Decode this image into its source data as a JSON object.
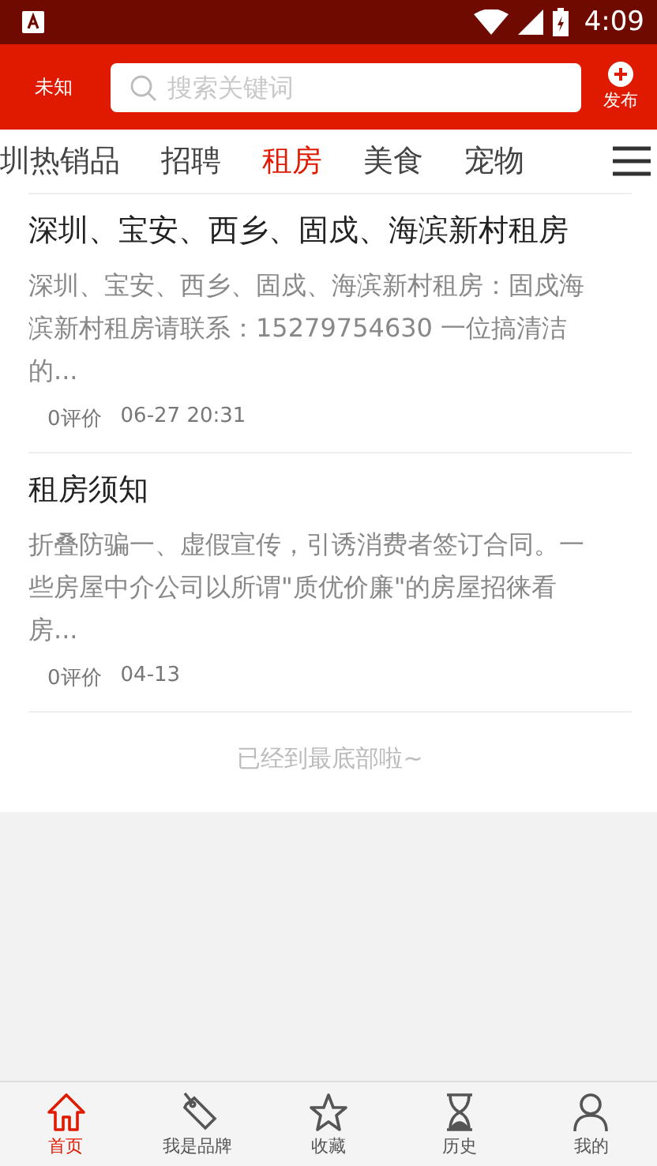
{
  "status_bar": {
    "time": "4:09"
  },
  "header": {
    "location": "未知",
    "search": {
      "placeholder": "搜索关键词"
    },
    "publish": "发布"
  },
  "tabs": [
    {
      "label": "圳热销品",
      "selected": false
    },
    {
      "label": "招聘",
      "selected": false
    },
    {
      "label": "租房",
      "selected": true
    },
    {
      "label": "美食",
      "selected": false
    },
    {
      "label": "宠物",
      "selected": false
    }
  ],
  "posts": [
    {
      "title": "深圳、宝安、西乡、固戍、海滨新村租房",
      "summary": "深圳、宝安、西乡、固戍、海滨新村租房：固戍海滨新村租房请联系：15279754630 一位搞清洁的...",
      "reviews": "0评价",
      "date": "06-27 20:31"
    },
    {
      "title": "租房须知",
      "summary": "折叠防骗一、虚假宣传，引诱消费者签订合同。一些房屋中介公司以所谓\"质优价廉\"的房屋招徕看房...",
      "reviews": "0评价",
      "date": "04-13"
    }
  ],
  "end_note": "已经到最底部啦~",
  "bottom_nav": [
    {
      "label": "首页",
      "kind": "home",
      "selected": true
    },
    {
      "label": "我是品牌",
      "kind": "tag",
      "selected": false
    },
    {
      "label": "收藏",
      "kind": "star",
      "selected": false
    },
    {
      "label": "历史",
      "kind": "hourglass",
      "selected": false
    },
    {
      "label": "我的",
      "kind": "person",
      "selected": false
    }
  ]
}
